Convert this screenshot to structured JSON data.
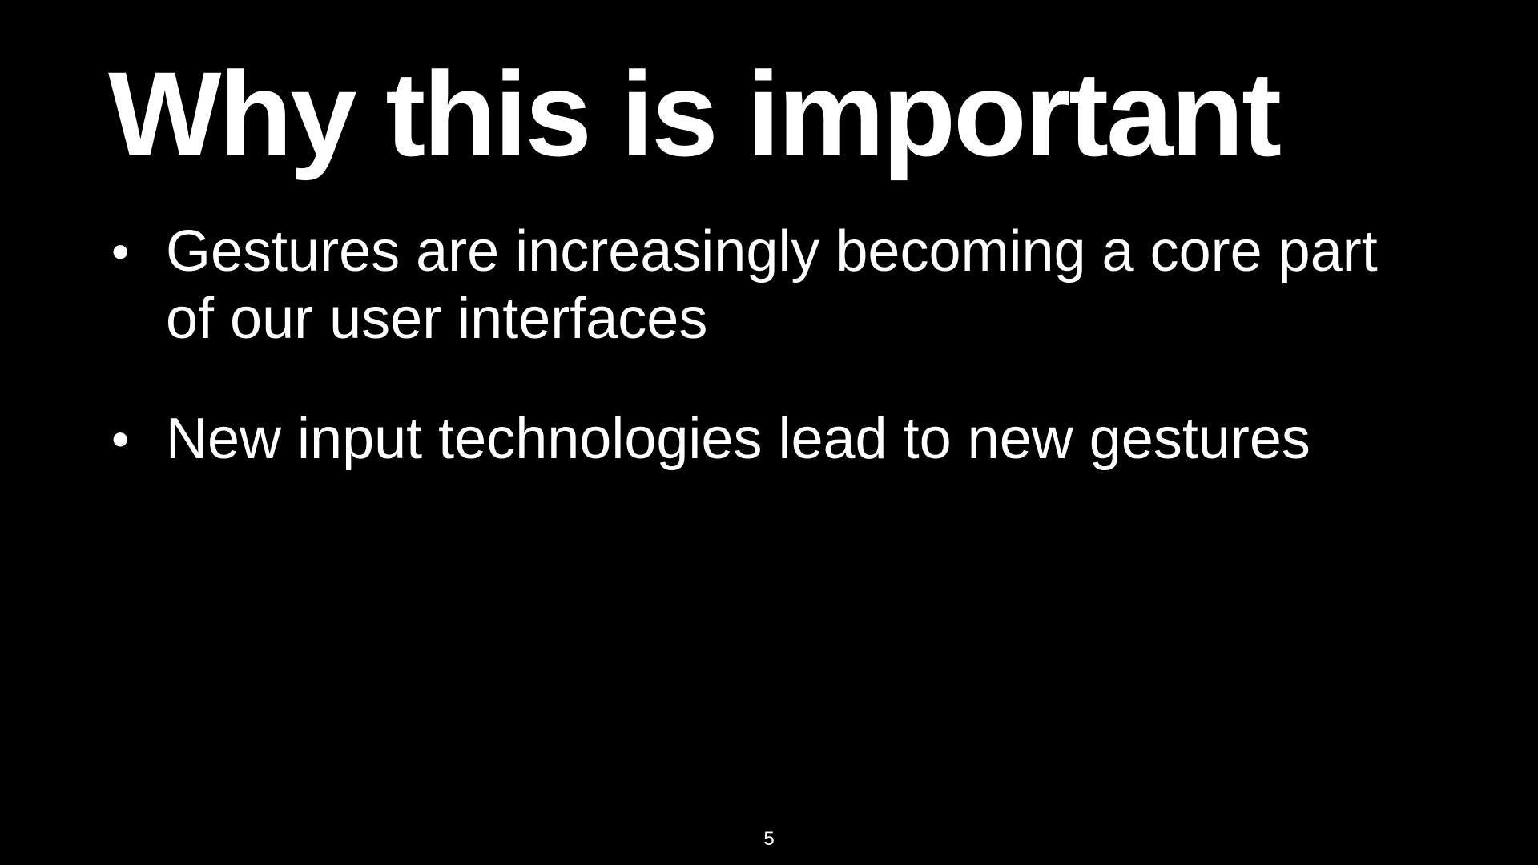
{
  "slide": {
    "title": "Why this is important",
    "bullets": [
      {
        "marker": "•",
        "text": "Gestures are increasingly becoming a core part of our user interfaces"
      },
      {
        "marker": "•",
        "text": "New input technologies lead to new gestures"
      }
    ],
    "page_number": "5"
  },
  "colors": {
    "background": "#000000",
    "text": "#ffffff"
  }
}
